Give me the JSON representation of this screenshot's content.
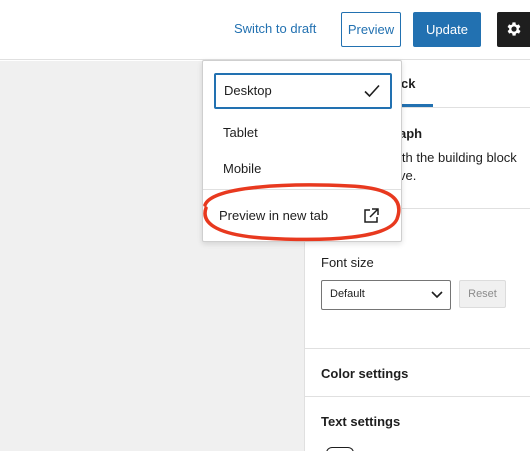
{
  "header": {
    "switch_to_draft": "Switch to draft",
    "preview": "Preview",
    "update": "Update",
    "settings_icon": "gear-icon"
  },
  "preview_menu": {
    "items": [
      {
        "label": "Desktop",
        "selected": true,
        "icon": "check-icon"
      },
      {
        "label": "Tablet"
      },
      {
        "label": "Mobile"
      }
    ],
    "new_tab": {
      "label": "Preview in new tab",
      "icon": "external-link-icon"
    }
  },
  "sidebar": {
    "tab_fragment": "ck",
    "block_title_fragment": "aph",
    "block_desc_line1": "ith the building block",
    "block_desc_line2": "ve.",
    "font_size_label": "Font size",
    "font_size_value": "Default",
    "reset_label": "Reset",
    "color_settings": "Color settings",
    "text_settings": "Text settings"
  },
  "colors": {
    "accent": "#2271b1",
    "annotation": "#e8391f",
    "canvas": "#f0f0f0"
  }
}
